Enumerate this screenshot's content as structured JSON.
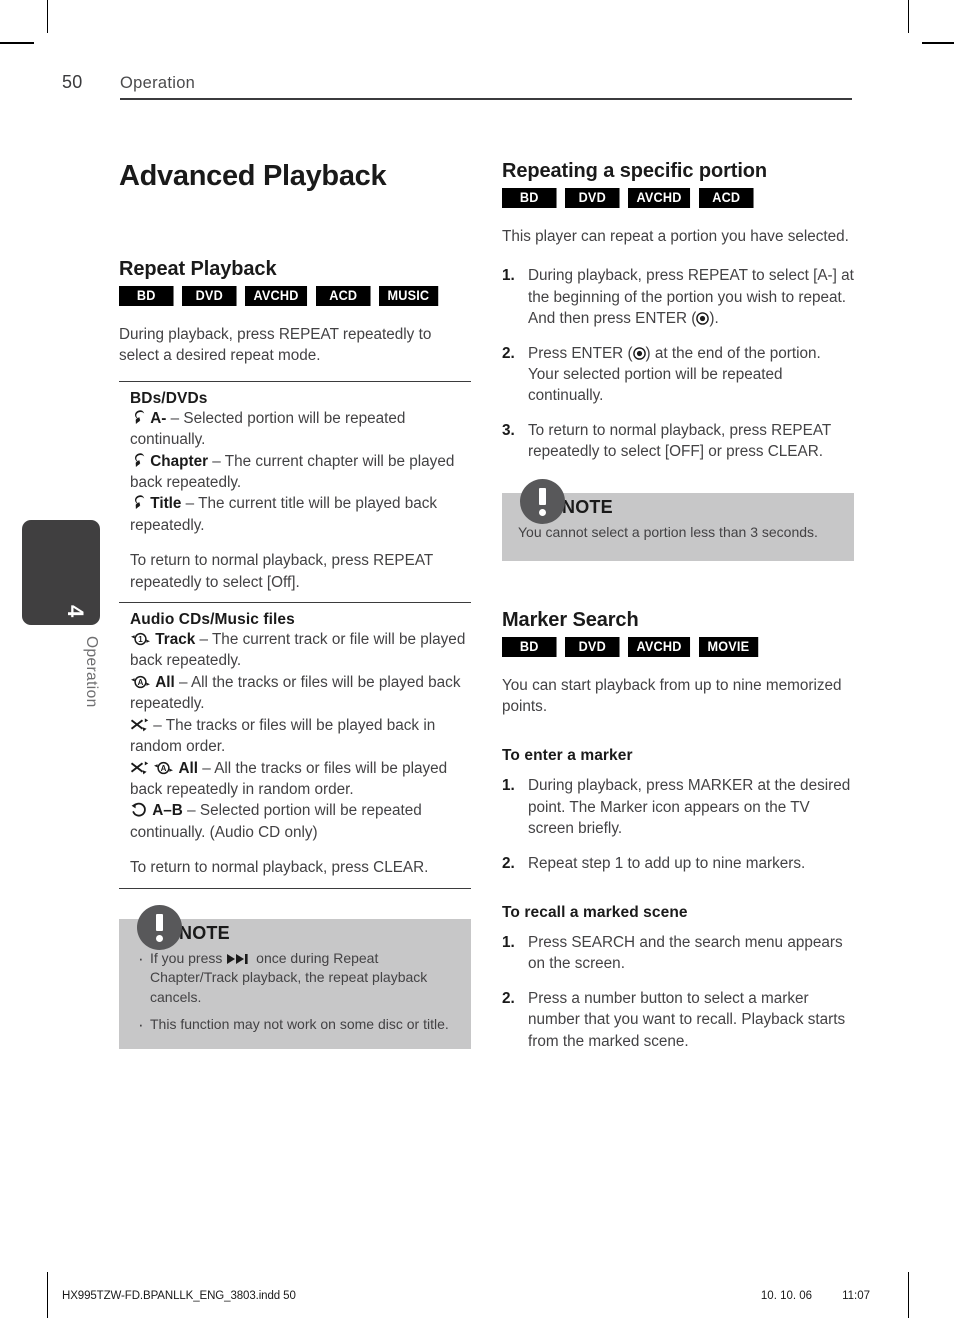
{
  "header": {
    "page_number": "50",
    "title": "Operation"
  },
  "side_tab": {
    "chapter_number": "4",
    "chapter_label": "Operation"
  },
  "left_column": {
    "chapter_title": "Advanced Playback",
    "section": {
      "title": "Repeat Playback",
      "badges": [
        "BD",
        "DVD",
        "AVCHD",
        "ACD",
        "MUSIC"
      ],
      "intro": "During playback, press REPEAT repeatedly to select a desired repeat mode.",
      "group_bd": {
        "heading": "BDs/DVDs",
        "items": [
          {
            "icon": "repeat-arrow-icon",
            "term": "A-",
            "desc": "– Selected portion will be repeated continually."
          },
          {
            "icon": "repeat-arrow-icon",
            "term": "Chapter",
            "desc": "– The current chapter will be played back repeatedly."
          },
          {
            "icon": "repeat-arrow-icon",
            "term": "Title",
            "desc": "– The current title will be played back repeatedly."
          }
        ],
        "footer_note": "To return to normal playback, press REPEAT repeatedly to select [Off]."
      },
      "group_acd": {
        "heading": "Audio CDs/Music files",
        "items": [
          {
            "icon": "repeat-one-icon",
            "term": "Track",
            "desc": "– The current track or file will be played back repeatedly."
          },
          {
            "icon": "repeat-all-icon",
            "term": "All",
            "desc": "– All the tracks or files will be played back repeatedly."
          },
          {
            "icon": "shuffle-icon",
            "term": "",
            "desc": "– The tracks or files will be played back in random order."
          },
          {
            "icon": "shuffle-repeat-all-icon",
            "term": "All",
            "desc": "– All the tracks or files will be played back repeatedly in random order."
          },
          {
            "icon": "repeat-ab-icon",
            "term": "A–B",
            "desc": "– Selected portion will be repeated continually. (Audio CD only)"
          }
        ],
        "footer_note": "To return to normal playback, press CLEAR."
      }
    },
    "note": {
      "label": "NOTE",
      "items": [
        "If you press ▶▶❘ once during Repeat Chapter/Track playback, the repeat playback cancels.",
        "This function may not work on some disc or title."
      ],
      "item1_before": "If you press",
      "item1_icon": "skip-forward-icon",
      "item1_after": "once during Repeat Chapter/Track playback, the repeat playback cancels.",
      "item2": "This function may not work on some disc or title."
    }
  },
  "right_column": {
    "section_repeat_portion": {
      "title": "Repeating a specific portion",
      "badges": [
        "BD",
        "DVD",
        "AVCHD",
        "ACD"
      ],
      "intro": "This player can repeat a portion you have selected.",
      "steps": [
        {
          "num": "1.",
          "before": "During playback, press REPEAT to select [A-] at the beginning of the portion you wish to repeat. And then press ENTER (",
          "icon": "enter-button-icon",
          "after": ")."
        },
        {
          "num": "2.",
          "before": "Press ENTER (",
          "icon": "enter-button-icon",
          "after": ") at the end of the portion. Your selected portion will be repeated continually."
        },
        {
          "num": "3.",
          "before": "To return to normal playback, press REPEAT repeatedly to select [OFF] or press CLEAR.",
          "icon": "",
          "after": ""
        }
      ],
      "note": {
        "label": "NOTE",
        "text": "You cannot select a portion less than 3 seconds."
      }
    },
    "section_marker_search": {
      "title": "Marker Search",
      "badges": [
        "BD",
        "DVD",
        "AVCHD",
        "MOVIE"
      ],
      "intro": "You can start playback from up to nine memorized points.",
      "enter_marker": {
        "heading": "To enter a marker",
        "steps": [
          {
            "num": "1.",
            "text": "During playback, press MARKER at the desired point. The Marker icon appears on the TV screen briefly."
          },
          {
            "num": "2.",
            "text": "Repeat step 1 to add up to nine markers."
          }
        ]
      },
      "recall_marker": {
        "heading": "To recall a marked scene",
        "steps": [
          {
            "num": "1.",
            "text": "Press SEARCH and the search menu appears on the screen."
          },
          {
            "num": "2.",
            "text": "Press a number button to select a marker number that you want to recall. Playback starts from the marked scene."
          }
        ]
      }
    }
  },
  "footer": {
    "file_name": "HX995TZW-FD.BPANLLK_ENG_3803.indd   50",
    "date": "10. 10. 06",
    "time": "11:07"
  },
  "colors": {
    "badge_bg": "#000000",
    "badge_text": "#ffffff",
    "note_bg": "#c7c7c8",
    "note_circle": "#58585a",
    "side_tab_bg": "#403f40",
    "body_text": "#434244",
    "heading_text": "#1a1a1a"
  }
}
